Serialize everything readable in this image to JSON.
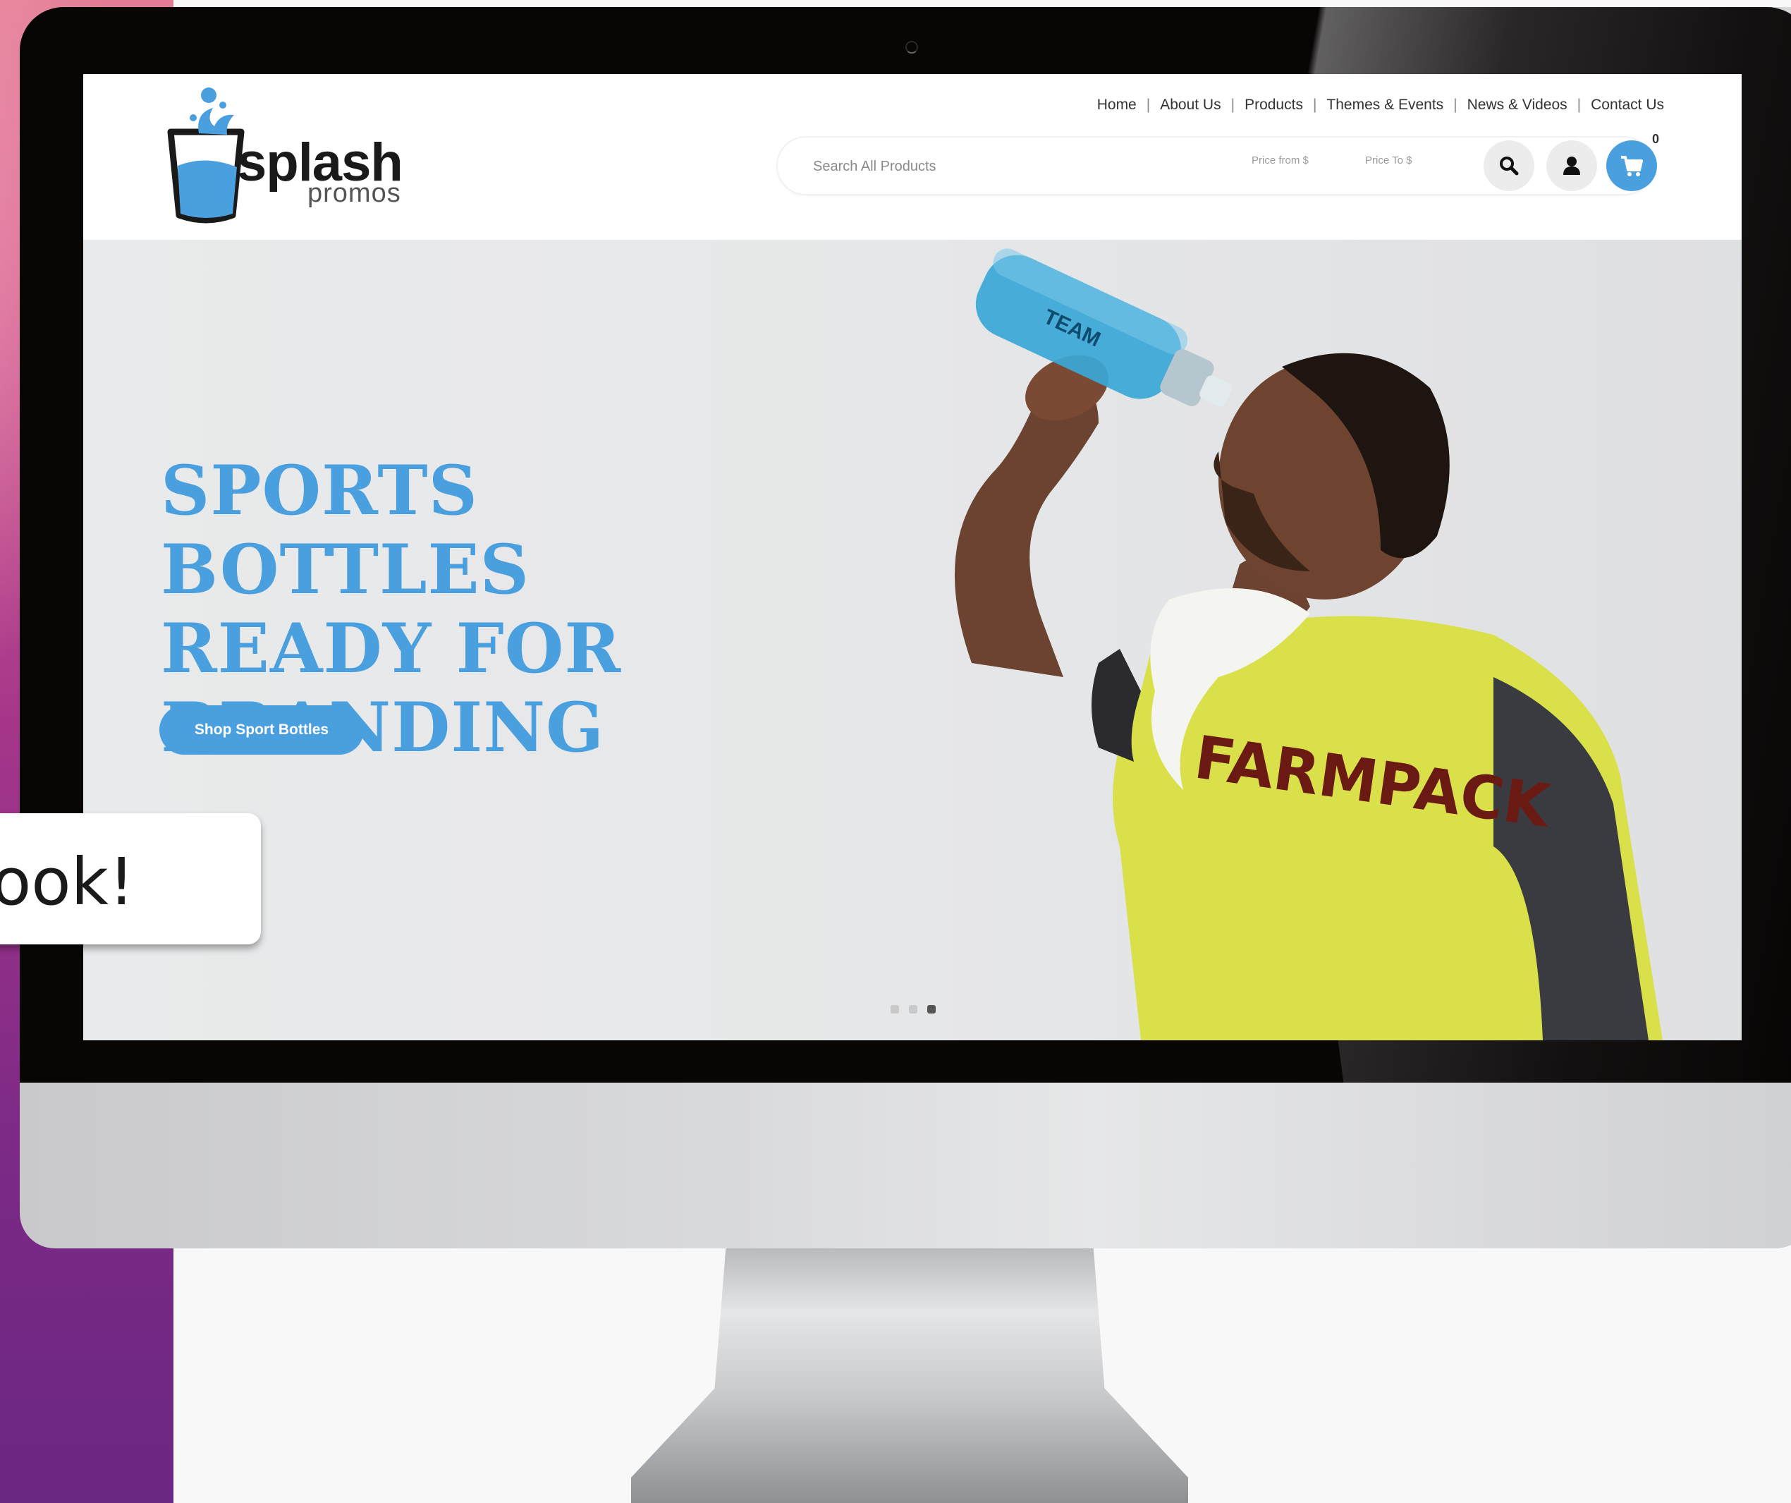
{
  "nav": {
    "items": [
      "Home",
      "About Us",
      "Products",
      "Themes & Events",
      "News & Videos",
      "Contact Us"
    ]
  },
  "logo": {
    "name": "splash",
    "sub": "promos"
  },
  "search": {
    "placeholder": "Search All Products",
    "price_from": "Price from $",
    "price_to": "Price To $"
  },
  "cart": {
    "count": "0"
  },
  "hero": {
    "title": "SPORTS BOTTLES READY FOR BRANDING",
    "cta_label": "Shop Sport Bottles",
    "shirt_text": "FARMPACK",
    "slides": 3,
    "active_slide": 3
  },
  "tooltip": {
    "text": "ook!"
  },
  "colors": {
    "brand_blue": "#4a9fde",
    "shirt_yellow": "#d9e04a",
    "background_purple": "#7d2a86"
  },
  "icons": {
    "search": "search-icon",
    "user": "user-icon",
    "cart": "cart-icon"
  }
}
